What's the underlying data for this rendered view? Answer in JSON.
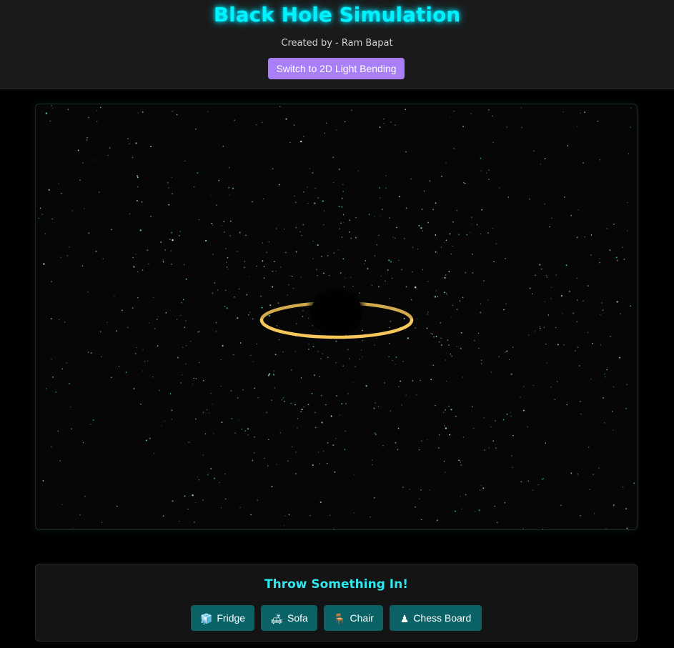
{
  "header": {
    "title": "Black Hole Simulation",
    "subtitle": "Created by - Ram Bapat",
    "mode_button": "Switch to 2D Light Bending"
  },
  "simulation": {
    "ring_color": "#f7c75a",
    "background_color": "#060606",
    "star_colors": [
      "#9ef0d0",
      "#6fd8b8",
      "#d8f5ee",
      "#48c8a8"
    ]
  },
  "throw_panel": {
    "title": "Throw Something In!",
    "buttons": [
      {
        "label": "Fridge",
        "icon": "fridge-icon",
        "glyph": "🧊"
      },
      {
        "label": "Sofa",
        "icon": "sofa-icon",
        "glyph": "🛋"
      },
      {
        "label": "Chair",
        "icon": "chair-icon",
        "glyph": "🪑"
      },
      {
        "label": "Chess Board",
        "icon": "chess-icon",
        "glyph": "♟"
      }
    ]
  },
  "colors": {
    "title_glow": "#00f2ff",
    "mode_button_bg": "#a87ff8",
    "object_button_bg": "#0a6266",
    "section_title": "#2ee8ee"
  }
}
